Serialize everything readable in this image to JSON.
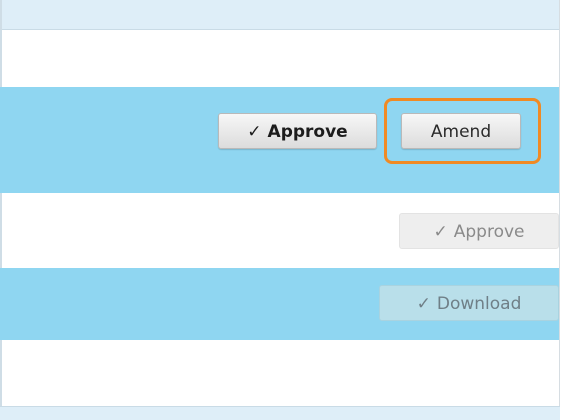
{
  "rows": [
    {
      "approve_button": {
        "icon": "check-icon",
        "glyph": "✓",
        "label": "Approve"
      },
      "amend_button": {
        "label": "Amend"
      }
    },
    {
      "approve_button": {
        "icon": "check-icon",
        "glyph": "✓",
        "label": "Approve"
      }
    },
    {
      "download_button": {
        "icon": "check-icon",
        "glyph": "✓",
        "label": "Download"
      }
    }
  ],
  "colors": {
    "row_highlight": "#8fd6f1",
    "header_bg": "#deeef8",
    "focus_outline": "#f08a24"
  }
}
